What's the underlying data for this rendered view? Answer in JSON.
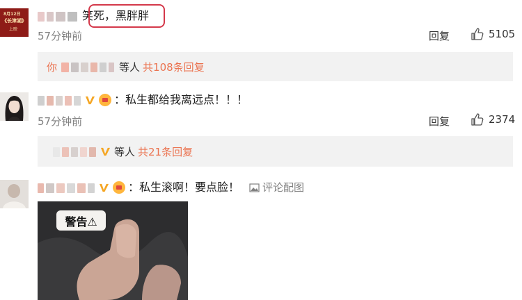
{
  "comments": [
    {
      "text": "笑死，黑胖胖",
      "time": "57分钟前",
      "reply_label": "回复",
      "likes": "5105",
      "avatar": {
        "line1": "8月12日",
        "line2": "《长津湖》",
        "line3": "上映"
      },
      "sub_replies": {
        "prefix": "你",
        "others": "等人",
        "count_text": "共108条回复"
      }
    },
    {
      "text": "：私生都给我离远点！！！",
      "time": "57分钟前",
      "reply_label": "回复",
      "likes": "2374",
      "sub_replies": {
        "others": "等人",
        "count_text": "共21条回复"
      }
    },
    {
      "text": "：私生滚啊！要点脸！",
      "pic_link": "评论配图",
      "image_badge": "警告⚠"
    }
  ],
  "colors": {
    "accent": "#eb7350",
    "highlight": "#d4384a",
    "reply_bg": "#f2f2f2",
    "meta": "#808080"
  }
}
